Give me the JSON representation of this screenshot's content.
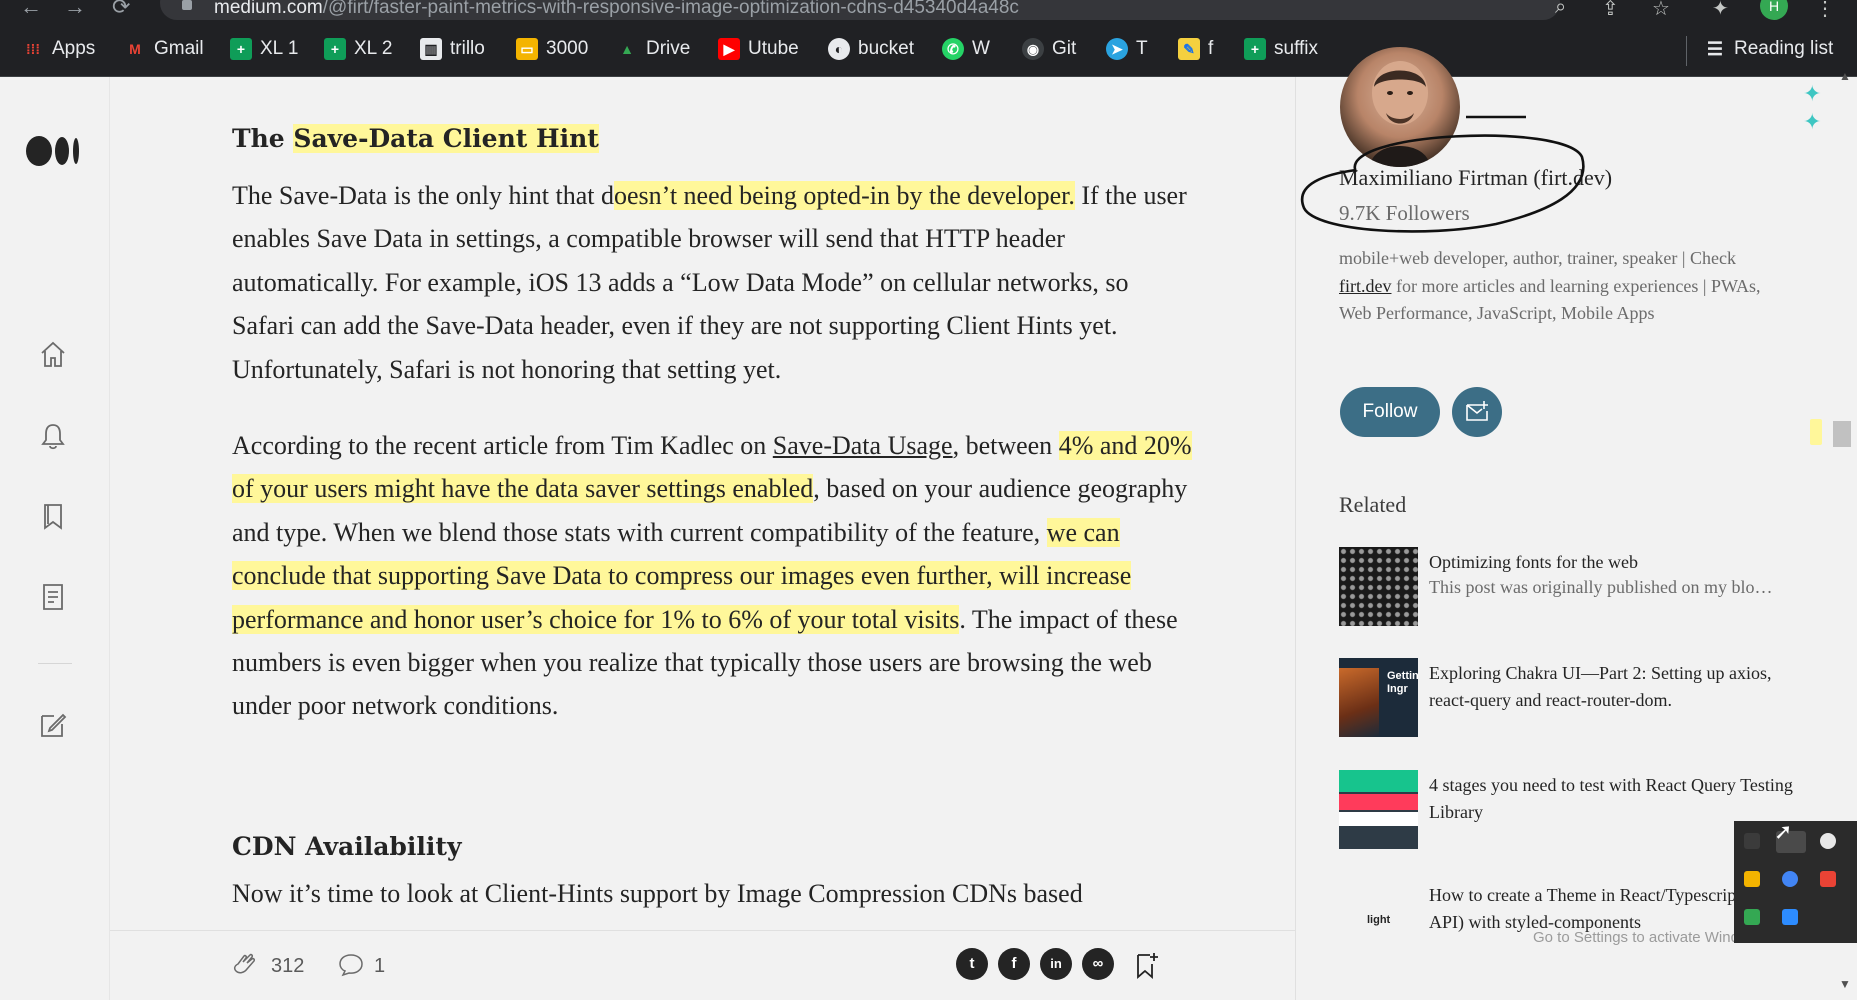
{
  "browser": {
    "url_host": "medium.com",
    "url_path": "/@firt/faster-paint-metrics-with-responsive-image-optimization-cdns-d45340d4a48c",
    "profile_initial": "H",
    "bookmarks": [
      {
        "label": "Apps",
        "icon": "apps-grid-icon",
        "color": "#4285f4"
      },
      {
        "label": "Gmail",
        "icon": "gmail-icon",
        "color": "#ea4335"
      },
      {
        "label": "XL 1",
        "icon": "sheets-icon",
        "color": "#0f9d58"
      },
      {
        "label": "XL 2",
        "icon": "sheets-icon",
        "color": "#0f9d58"
      },
      {
        "label": "trillo",
        "icon": "trello-icon",
        "color": "#e8eaed"
      },
      {
        "label": "3000",
        "icon": "slides-icon",
        "color": "#f4b400"
      },
      {
        "label": "Drive",
        "icon": "drive-icon",
        "color": "#34a853"
      },
      {
        "label": "Utube",
        "icon": "youtube-icon",
        "color": "#ff0000"
      },
      {
        "label": "bucket",
        "icon": "globe-icon",
        "color": "#e8eaed"
      },
      {
        "label": "W",
        "icon": "whatsapp-icon",
        "color": "#25d366"
      },
      {
        "label": "Git",
        "icon": "github-icon",
        "color": "#3c4043"
      },
      {
        "label": "T",
        "icon": "telegram-icon",
        "color": "#2aa3e0"
      },
      {
        "label": "f",
        "icon": "note-icon",
        "color": "#f4d03f"
      },
      {
        "label": "suffix",
        "icon": "sheets-icon",
        "color": "#0f9d58"
      }
    ],
    "reading_list": "Reading list"
  },
  "article": {
    "heading1_prefix": "The ",
    "heading1_highlight": "Save-Data Client Hint",
    "p1_a": "The Save-Data is the only hint that d",
    "p1_hl": "oesn’t need being opted-in by the developer.",
    "p1_b": " If the user enables Save Data in settings, a compatible browser will send that HTTP header automatically. For example, iOS 13 adds a “Low Data Mode” on cellular networks, so Safari can add the Save-Data header, even if they are not supporting Client Hints yet. Unfortunately, Safari is not honoring that setting yet.",
    "p2_a": "According to the recent article from Tim Kadlec on ",
    "p2_link": "Save-Data Usage",
    "p2_b": ", between ",
    "p2_hl1": "4% and 20% of your users might have the data saver settings enabled",
    "p2_c": ", based on your audience geography and type. When we blend those stats with current compatibility of the feature, ",
    "p2_hl2": "we can conclude that supporting Save Data to compress our images even further, will increase performance and honor user’s choice for 1% to 6% of your total visits",
    "p2_d": ". The impact of these numbers is even bigger when you realize that typically those users are browsing the web under poor network conditions.",
    "heading2": "CDN Availability",
    "p3": "Now it’s time to look at Client-Hints support by Image Compression CDNs based",
    "claps": "312",
    "responses": "1"
  },
  "sidebar": {
    "author_name": "Maximiliano Firtman (firt.dev)",
    "followers": "9.7K Followers",
    "bio_a": "mobile+web developer, author, trainer, speaker | Check ",
    "bio_link": "firt.dev",
    "bio_b": " for more articles and learning experiences | PWAs, Web Performance, JavaScript, Mobile Apps",
    "follow_label": "Follow",
    "related_heading": "Related",
    "related": [
      {
        "title": "Optimizing fonts for the web",
        "subtitle": "This post was originally published on my blo…"
      },
      {
        "title": "Exploring Chakra UI—Part 2: Setting up axios, react-query and react-router-dom.",
        "subtitle": ""
      },
      {
        "title": "4 stages you need to test with React Query Testing Library",
        "subtitle": ""
      },
      {
        "title": "How to create a Theme in React/Typescript (Context API) with styled-components",
        "subtitle": ""
      }
    ],
    "thumb4_text": "light",
    "thumb2_text": "Getting Ingr",
    "windows_watermark": "Go to Settings to activate Windows."
  }
}
